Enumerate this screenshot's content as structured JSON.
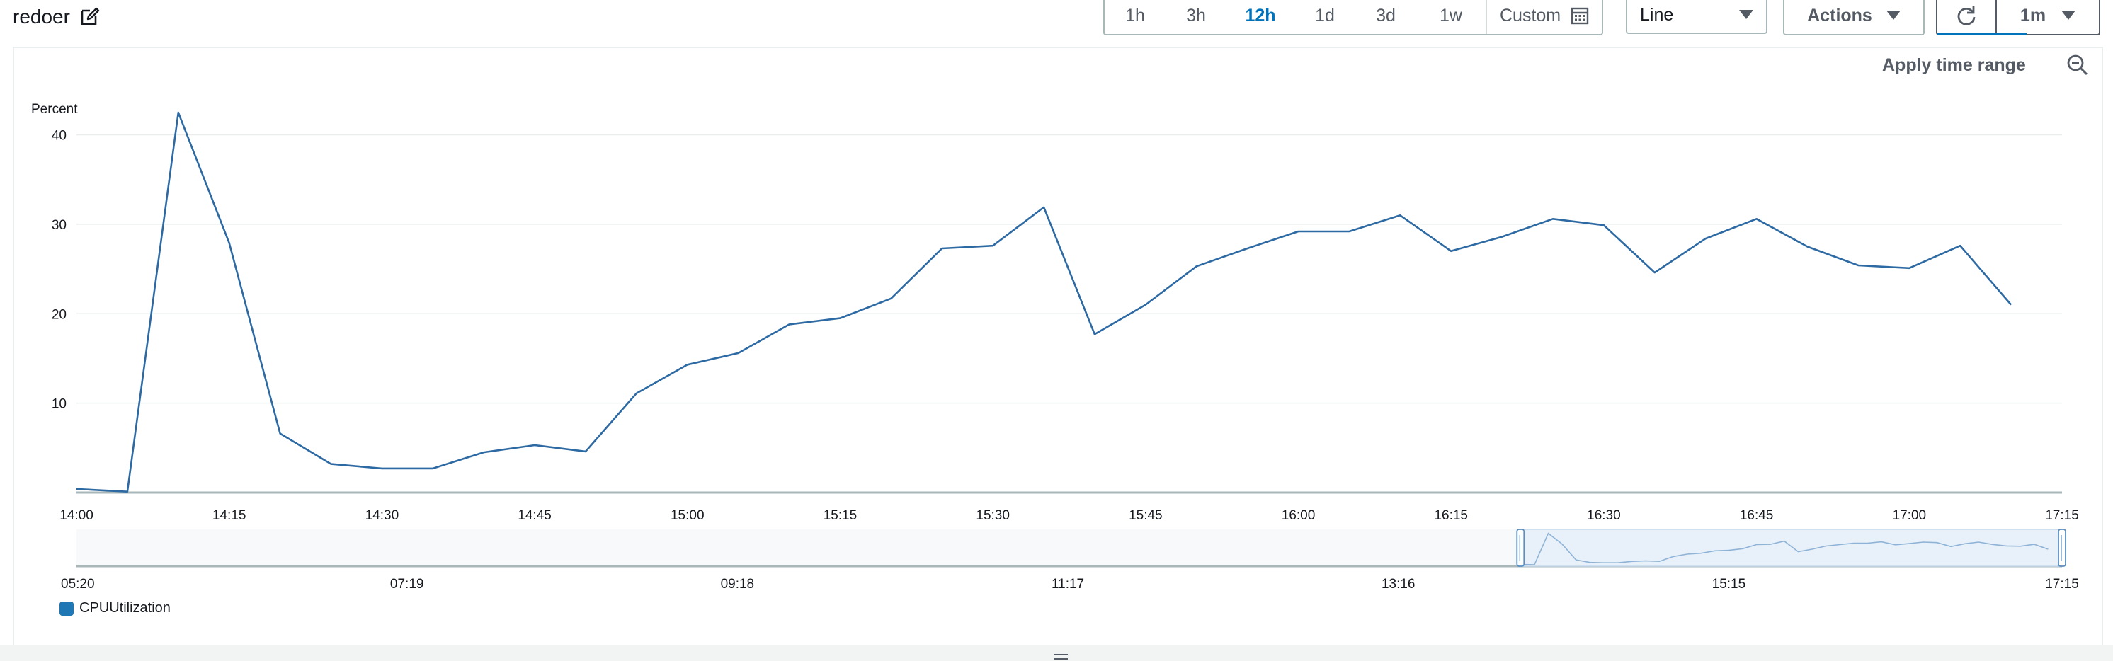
{
  "header": {
    "title": "redoer",
    "time_ranges": [
      "1h",
      "3h",
      "12h",
      "1d",
      "3d",
      "1w"
    ],
    "active_range": "12h",
    "custom_label": "Custom",
    "view_type": "Line",
    "actions_label": "Actions",
    "refresh_interval": "1m"
  },
  "panel": {
    "apply_time_range_label": "Apply time range"
  },
  "colors": {
    "series": "#2d6aa3",
    "accent": "#0073bb",
    "grid": "#eaeded",
    "axis": "#aab7b8"
  },
  "chart_data": {
    "type": "line",
    "ylabel": "Percent",
    "yticks": [
      10,
      20,
      30,
      40
    ],
    "ylim": [
      0,
      44
    ],
    "xlim": [
      "14:00",
      "17:15"
    ],
    "xticks": [
      "14:00",
      "14:15",
      "14:30",
      "14:45",
      "15:00",
      "15:15",
      "15:30",
      "15:45",
      "16:00",
      "16:15",
      "16:30",
      "16:45",
      "17:00",
      "17:15"
    ],
    "series": [
      {
        "name": "CPUUtilization",
        "x": [
          "14:00",
          "14:05",
          "14:10",
          "14:15",
          "14:20",
          "14:25",
          "14:30",
          "14:35",
          "14:40",
          "14:45",
          "14:50",
          "14:55",
          "15:00",
          "15:05",
          "15:10",
          "15:15",
          "15:20",
          "15:25",
          "15:30",
          "15:35",
          "15:40",
          "15:45",
          "15:50",
          "15:55",
          "16:00",
          "16:05",
          "16:10",
          "16:15",
          "16:20",
          "16:25",
          "16:30",
          "16:35",
          "16:40",
          "16:45",
          "16:50",
          "16:55",
          "17:00",
          "17:05",
          "17:10"
        ],
        "values": [
          0.4,
          0.1,
          42.5,
          27.9,
          6.6,
          3.2,
          2.7,
          2.7,
          4.5,
          5.3,
          4.6,
          11.1,
          14.3,
          15.6,
          18.8,
          19.5,
          21.7,
          27.3,
          27.6,
          31.9,
          17.7,
          21.0,
          25.3,
          27.3,
          29.2,
          29.2,
          31.0,
          27.0,
          28.6,
          30.6,
          29.9,
          24.6,
          28.4,
          30.6,
          27.5,
          25.4,
          25.1,
          27.6,
          21.0
        ]
      }
    ],
    "navigator": {
      "ticks": [
        "05:20",
        "07:19",
        "09:18",
        "11:17",
        "13:16",
        "15:15",
        "17:15"
      ],
      "window": [
        "14:00",
        "17:15"
      ]
    },
    "legend": "bottom-left"
  }
}
